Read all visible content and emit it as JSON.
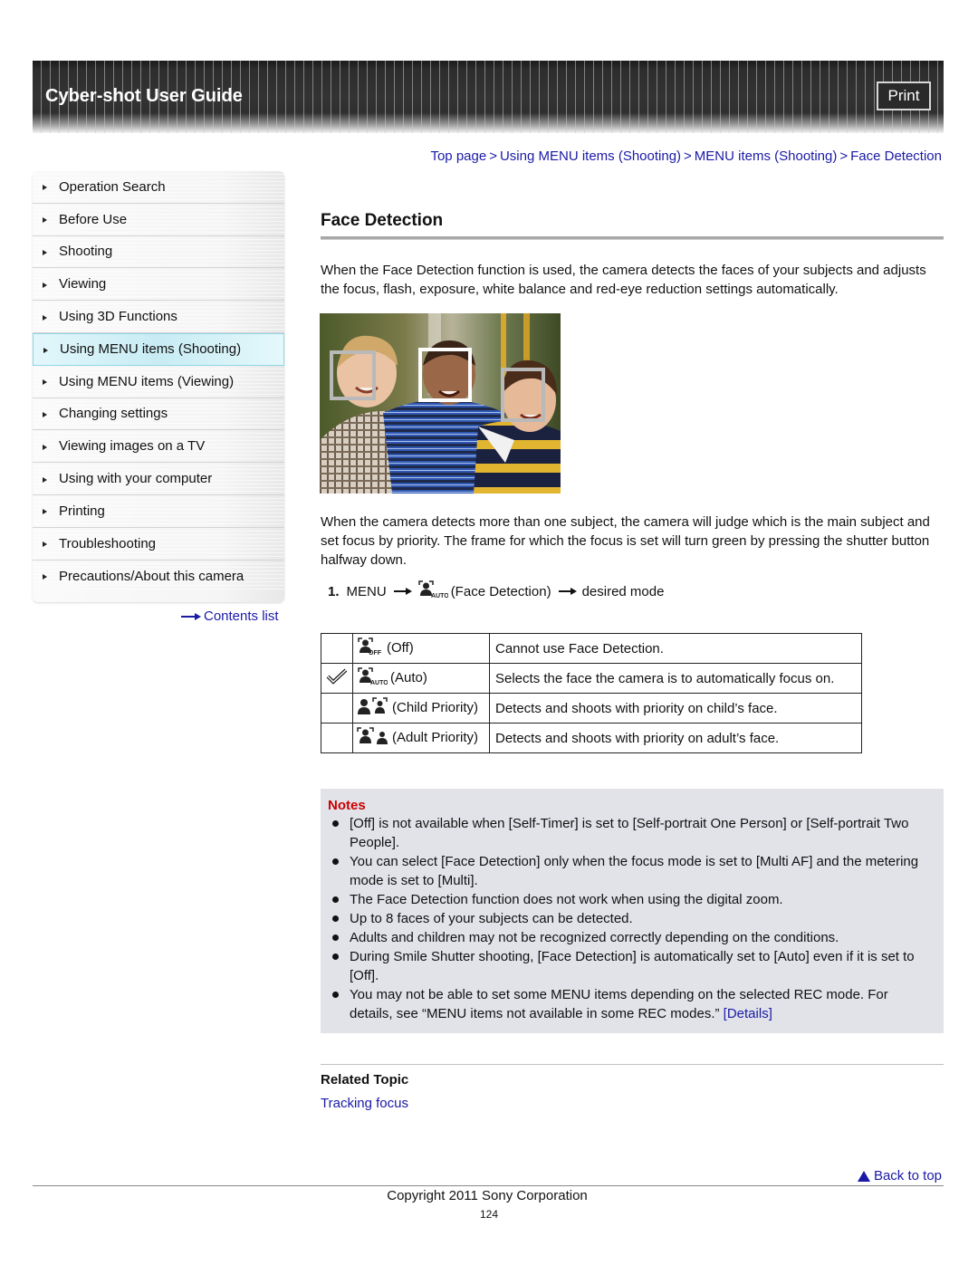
{
  "header": {
    "title": "Cyber-shot User Guide",
    "print_label": "Print"
  },
  "sidebar": {
    "items": [
      {
        "label": "Operation Search",
        "active": false
      },
      {
        "label": "Before Use",
        "active": false
      },
      {
        "label": "Shooting",
        "active": false
      },
      {
        "label": "Viewing",
        "active": false
      },
      {
        "label": "Using 3D Functions",
        "active": false
      },
      {
        "label": "Using MENU items (Shooting)",
        "active": true
      },
      {
        "label": "Using MENU items (Viewing)",
        "active": false
      },
      {
        "label": "Changing settings",
        "active": false
      },
      {
        "label": "Viewing images on a TV",
        "active": false
      },
      {
        "label": "Using with your computer",
        "active": false
      },
      {
        "label": "Printing",
        "active": false
      },
      {
        "label": "Troubleshooting",
        "active": false
      },
      {
        "label": "Precautions/About this camera",
        "active": false
      }
    ],
    "contents_link": "Contents list"
  },
  "breadcrumb": {
    "items": [
      "Top page",
      "Using MENU items (Shooting)",
      "MENU items (Shooting)",
      "Face Detection"
    ],
    "separator": ">"
  },
  "main": {
    "title": "Face Detection",
    "intro": "When the Face Detection function is used, the camera detects the faces of your subjects and adjusts the focus, flash, exposure, white balance and red-eye reduction settings automatically.",
    "photo_alt": "Three smiling children with face detection frames",
    "priority_text": "When the camera detects more than one subject, the camera will judge which is the main subject and set focus by priority. The frame for which the focus is set will turn green by pressing the shutter button halfway down.",
    "step": {
      "number": "1.",
      "menu": "MENU",
      "item": "(Face Detection)",
      "target": "desired mode"
    },
    "modes": [
      {
        "checked": false,
        "icon": "face-detection-off-icon",
        "label": "(Off)",
        "description": "Cannot use Face Detection."
      },
      {
        "checked": true,
        "icon": "face-detection-auto-icon",
        "label": "(Auto)",
        "description": "Selects the face the camera is to automatically focus on."
      },
      {
        "checked": false,
        "icon": "child-priority-icon",
        "label": "(Child Priority)",
        "description": "Detects and shoots with priority on child’s face."
      },
      {
        "checked": false,
        "icon": "adult-priority-icon",
        "label": "(Adult Priority)",
        "description": "Detects and shoots with priority on adult’s face."
      }
    ]
  },
  "notes": {
    "title": "Notes",
    "items": [
      "[Off] is not available when [Self-Timer] is set to [Self-portrait One Person] or [Self-portrait Two People].",
      "You can select [Face Detection] only when the focus mode is set to [Multi AF] and the metering mode is set to [Multi].",
      "The Face Detection function does not work when using the digital zoom.",
      "Up to 8 faces of your subjects can be detected.",
      "Adults and children may not be recognized correctly depending on the conditions.",
      "During Smile Shutter shooting, [Face Detection] is automatically set to [Auto] even if it is set to [Off].",
      "You may not be able to set some MENU items depending on the selected REC mode. For details, see “MENU items not available in some REC modes.”"
    ],
    "details_link": "[Details]"
  },
  "related": {
    "title": "Related Topic",
    "links": [
      "Tracking focus"
    ]
  },
  "footer": {
    "back_to_top": "Back to top",
    "copyright": "Copyright 2011 Sony Corporation",
    "page_number": "124"
  },
  "colors": {
    "link": "#1a1aa6",
    "notes_title": "#cc0000",
    "notes_bg": "#e1e3e9",
    "active_nav": "#c8ecf4"
  }
}
